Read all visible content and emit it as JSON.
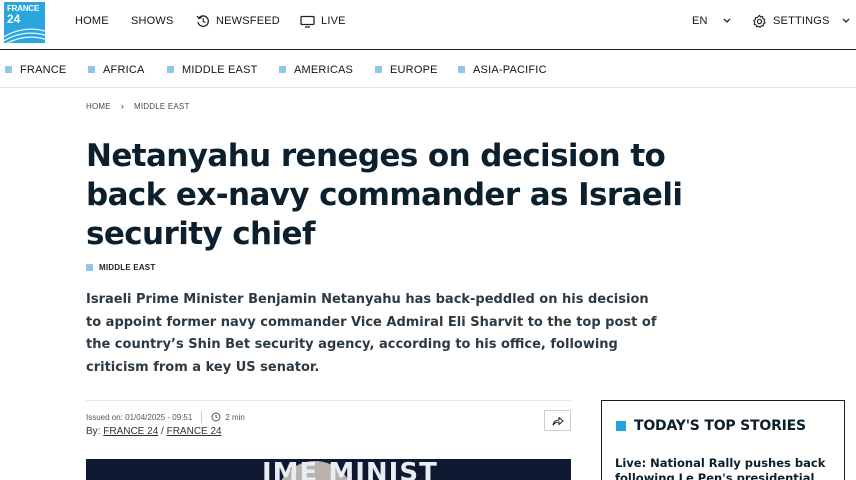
{
  "brand": {
    "logo_line1": "FRANCE",
    "logo_line2": "24",
    "accent": "#2aa6df"
  },
  "nav": {
    "home": "HOME",
    "shows": "SHOWS",
    "newsfeed": "NEWSFEED",
    "live": "LIVE",
    "language": "EN",
    "settings": "SETTINGS"
  },
  "regions": [
    "FRANCE",
    "AFRICA",
    "MIDDLE EAST",
    "AMERICAS",
    "EUROPE",
    "ASIA-PACIFIC"
  ],
  "breadcrumb": {
    "home": "HOME",
    "section": "MIDDLE EAST"
  },
  "article": {
    "headline": "Netanyahu reneges on decision to back ex-navy commander as Israeli security chief",
    "tag": "MIDDLE EAST",
    "lead": "Israeli Prime Minister Benjamin Netanyahu has back-peddled on his decision to appoint former navy commander Vice Admiral Eli Sharvit to the top post of the country’s Shin Bet security agency, according to his office, following criticism from a key US senator.",
    "issued": "Issued on: 01/04/2025 - 09:51",
    "read_time": "2 min",
    "by_label": "By:",
    "author1": "FRANCE 24",
    "author_sep": "/",
    "author2": "FRANCE 24",
    "hero_caption_text": "IME MINIST"
  },
  "sidebar": {
    "title": "TODAY'S TOP STORIES",
    "story1": "Live: National Rally pushes back following Le Pen's presidential ban"
  },
  "colors": {
    "region_square": "#8dc8ea",
    "sidebar_square": "#22a3dd",
    "headline": "#0c1f2c"
  }
}
